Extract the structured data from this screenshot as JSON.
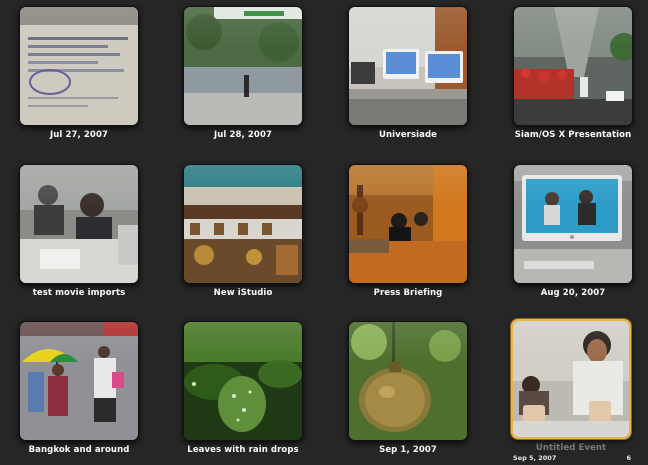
{
  "events": [
    {
      "title": "Jul 27, 2007"
    },
    {
      "title": "Jul 28, 2007"
    },
    {
      "title": "Universiade"
    },
    {
      "title": "Siam/OS X Presentation"
    },
    {
      "title": "test movie imports"
    },
    {
      "title": "New iStudio"
    },
    {
      "title": "Press Briefing"
    },
    {
      "title": "Aug 20, 2007"
    },
    {
      "title": "Bangkok and around"
    },
    {
      "title": "Leaves with rain drops"
    },
    {
      "title": "Sep 1, 2007"
    },
    {
      "title": "Untitled Event",
      "date": "Sep 5, 2007",
      "count": "6"
    }
  ],
  "colors": {
    "background": "#262626",
    "selection": "#e7b34a",
    "label": "#ffffff",
    "selected_label": "#7a7a7a"
  }
}
